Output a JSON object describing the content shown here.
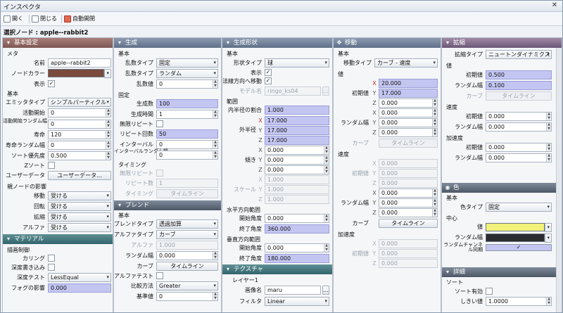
{
  "window": {
    "title": "インスペクタ",
    "close": "✕"
  },
  "toolbar": {
    "open": "開く",
    "close": "閉じる",
    "auto_open": "自動開閉"
  },
  "node": {
    "label": "選択ノード : apple--rabbit2"
  },
  "colors": {
    "node_color": "#7a4a3c",
    "color_value": "#f2f27a",
    "color_range": "#2a2a30",
    "accent_check": "#c4c6f2"
  },
  "basic": {
    "header": "基本設定",
    "meta": "メタ",
    "name_label": "名前",
    "name_value": "apple--rabbit2",
    "nodecolor_label": "ノードカラー",
    "show_label": "表示",
    "basic": "基本",
    "emitter_label": "エミッタタイプ",
    "emitter_value": "シンプルパーティクル",
    "act_start_label": "活動開始",
    "act_start_value": "0",
    "act_range_label": "活動開始ランダム幅",
    "act_range_value": "0",
    "life_label": "寿命",
    "life_value": "120",
    "life_range_label": "寿命ランダム幅",
    "life_range_value": "0",
    "sort_label": "ソート優先度",
    "sort_value": "0.500",
    "zsort_label": "Zソート",
    "userdata_label": "ユーザーデータ",
    "userdata_btn": "ユーザーデータ...",
    "parent": "親ノードの影響",
    "move_label": "移動",
    "move_value": "受ける",
    "rot_label": "回転",
    "rot_value": "受ける",
    "scale_label": "拡縮",
    "scale_value": "受ける",
    "alpha_label": "アルファ",
    "alpha_value": "受ける"
  },
  "material": {
    "header": "マテリアル",
    "draw": "描画制御",
    "culling_label": "カリング",
    "depth_write_label": "深度書き込み",
    "depth_test_label": "深度テスト",
    "depth_test_value": "LessEqual",
    "fog_label": "フォグの影響",
    "fog_value": "0.000"
  },
  "gen": {
    "header": "生成",
    "basic": "基本",
    "type_label": "乱数タイプ",
    "type_value": "固定",
    "seed_type_label": "乱数タイプ",
    "seed_type_value": "ランダム",
    "seed_label": "乱数値",
    "seed_value": "0",
    "fixed": "固定",
    "count_label": "生成数",
    "count_value": "100",
    "time_label": "生成時間",
    "time_value": "1",
    "inf_repeat_label": "無限リピート",
    "repeat_label": "リピート回数",
    "repeat_value": "50",
    "interval_label": "インターバル",
    "interval_value": "0",
    "interval_range_label": "インターバルランダム幅",
    "interval_range_value": "0",
    "timing": "タイミング",
    "timing_inf_label": "無限リピート",
    "timing_repeat_label": "リピート数",
    "timing_repeat_value": "1",
    "timing_label": "タイミング",
    "timing_btn": "タイムライン"
  },
  "blend": {
    "header": "ブレンド",
    "basic": "基本",
    "mode_label": "ブレンドタイプ",
    "mode_value": "透過加算",
    "alpha_type_label": "アルファタイプ",
    "alpha_type_value": "カーブ",
    "alpha_label": "アルファ",
    "alpha_value": "1.000",
    "alpha_range_label": "ランダム幅",
    "alpha_range_value": "0.000",
    "curve_label": "カーブ",
    "curve_btn": "タイムライン",
    "alpha_test_label": "アルファテスト",
    "cmp_label": "比較方法",
    "cmp_value": "Greater",
    "ref_label": "基準値",
    "ref_value": "0"
  },
  "shape": {
    "header": "生成形状",
    "basic": "基本",
    "type_label": "形状タイプ",
    "type_value": "球",
    "show_label": "表示",
    "normal_label": "法線方向へ移動",
    "model_label": "モデル名",
    "model_value": "ringo_ks04",
    "range": "範囲",
    "inner_label": "内半径の割合",
    "inner_value": "1.000",
    "outer_label": "外半径",
    "outer_x": "17.000",
    "outer_y": "17.000",
    "outer_z": "17.000",
    "tilt_label": "傾き",
    "tilt_x": "0.000",
    "tilt_y": "0.000",
    "tilt_z": "0.000",
    "scale_label": "スケール",
    "scale_x": "1.000",
    "scale_y": "1.000",
    "scale_z": "1.000",
    "hrange": "水平方向範囲",
    "h_start_label": "開始角度",
    "h_start_value": "0.000",
    "h_end_label": "終了角度",
    "h_end_value": "360.000",
    "vrange": "垂直方向範囲",
    "v_start_label": "開始角度",
    "v_start_value": "0.000",
    "v_end_label": "終了角度",
    "v_end_value": "180.000"
  },
  "texture": {
    "header": "テクスチャ",
    "layer": "レイヤー1",
    "image_label": "画像名",
    "image_value": "maru",
    "filter_label": "フィルタ",
    "filter_value": "Linear"
  },
  "move": {
    "header": "移動",
    "basic": "基本",
    "type_label": "移動タイプ",
    "type_value": "カーブ - 速度",
    "value": "値",
    "init_label": "初期値",
    "init_x": "20.000",
    "init_y": "17.000",
    "init_z": "0.000",
    "range_label": "ランダム幅",
    "range_x": "0.000",
    "range_y": "0.000",
    "range_z": "0.000",
    "curve_label": "カーブ",
    "curve_btn": "タイムライン",
    "velocity": "速度",
    "v_init_label": "初期値",
    "v_init_x": "0.000",
    "v_init_y": "0.000",
    "v_init_z": "0.000",
    "v_range_label": "ランダム幅",
    "v_range_x": "0.000",
    "v_range_y": "0.000",
    "v_range_z": "0.000",
    "v_curve_label": "カーブ",
    "v_curve_btn": "タイムライン",
    "accel": "加速度",
    "a_init_label": "初期値",
    "a_init_x": "0.000",
    "a_init_y": "0.000",
    "a_init_z": "0.000"
  },
  "scale": {
    "header": "拡縮",
    "type_label": "拡縮タイプ",
    "type_value": "ニュートンダイナミクス",
    "value": "値",
    "init_label": "初期値",
    "init_value": "0.500",
    "range_label": "ランダム幅",
    "range_value": "0.100",
    "curve_label": "カーブ",
    "curve_btn": "タイムライン",
    "velocity": "速度",
    "v_init_label": "初期値",
    "v_init_value": "0.000",
    "v_range_label": "ランダム幅",
    "v_range_value": "0.000",
    "accel": "加速度",
    "a_init_label": "初期値",
    "a_init_value": "0.000",
    "a_range_label": "ランダム幅",
    "a_range_value": "0.000"
  },
  "color": {
    "header": "色",
    "basic": "基本",
    "type_label": "色タイプ",
    "type_value": "固定",
    "center": "中心",
    "value_label": "値",
    "range_label": "ランダム幅",
    "channel_label": "ランダムチャンネル同期"
  },
  "detail": {
    "header": "詳細",
    "sort": "ソート",
    "sort_enable_label": "ソート有効",
    "threshold_label": "しきい値",
    "threshold_value": "1.0000"
  }
}
